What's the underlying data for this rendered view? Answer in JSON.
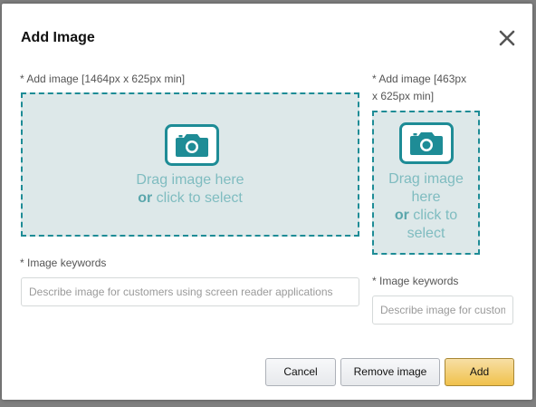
{
  "dialog": {
    "title": "Add Image",
    "close_icon": "close-icon"
  },
  "large_image": {
    "label": "* Add image [1464px x 625px min]",
    "drop_line1": "Drag image here",
    "drop_or": "or",
    "drop_line2": "click to select",
    "icon": "camera-icon",
    "keywords_label": "* Image keywords",
    "keywords_placeholder": "Describe image for customers using screen reader applications",
    "keywords_value": ""
  },
  "small_image": {
    "label_line1": "* Add image [463px",
    "label_line2": "x 625px min]",
    "drop_line1": "Drag image",
    "drop_line2": "here",
    "drop_or": "or",
    "drop_line3": "click to",
    "drop_line4": "select",
    "icon": "camera-icon",
    "keywords_label": "* Image keywords",
    "keywords_placeholder": "Describe image for customers using screen reader applications",
    "keywords_value": ""
  },
  "buttons": {
    "cancel": "Cancel",
    "remove": "Remove image",
    "add": "Add"
  },
  "colors": {
    "accent": "#1e8c96",
    "drop_bg": "#dde8e9",
    "primary_button": "#f0c14b"
  }
}
